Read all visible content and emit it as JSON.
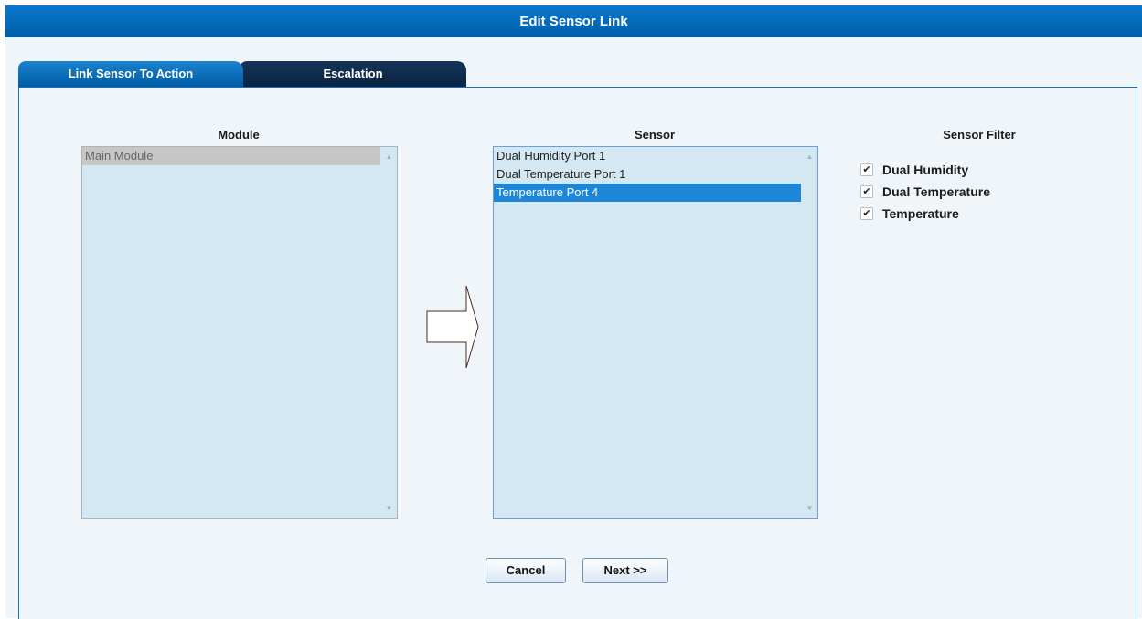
{
  "dialog": {
    "title": "Edit Sensor Link"
  },
  "tabs": [
    {
      "label": "Link Sensor To Action",
      "active": true
    },
    {
      "label": "Escalation",
      "active": false
    }
  ],
  "module_panel": {
    "label": "Module",
    "items": [
      "Main Module"
    ],
    "selected": "Main Module"
  },
  "sensor_panel": {
    "label": "Sensor",
    "items": [
      "Dual Humidity Port 1",
      "Dual Temperature Port 1",
      "Temperature Port 4"
    ],
    "selected": "Temperature Port 4"
  },
  "sensor_filter": {
    "label": "Sensor Filter",
    "options": [
      {
        "label": "Dual Humidity",
        "checked": true
      },
      {
        "label": "Dual Temperature",
        "checked": true
      },
      {
        "label": "Temperature",
        "checked": true
      }
    ]
  },
  "buttons": {
    "cancel": "Cancel",
    "next": "Next >>"
  },
  "colors": {
    "title_bar": "#0a6cc0",
    "active_tab": "#0b6fbf",
    "inactive_tab": "#0f2d4f",
    "list_background": "#d3e8f3",
    "list_selection": "#1e86d6",
    "panel_background": "#f0f5fa"
  },
  "icons": {
    "checkbox": "check-icon",
    "scroll_up": "scroll-up-arrow-icon",
    "scroll_down": "scroll-down-arrow-icon",
    "flow_arrow": "right-arrow-icon"
  }
}
